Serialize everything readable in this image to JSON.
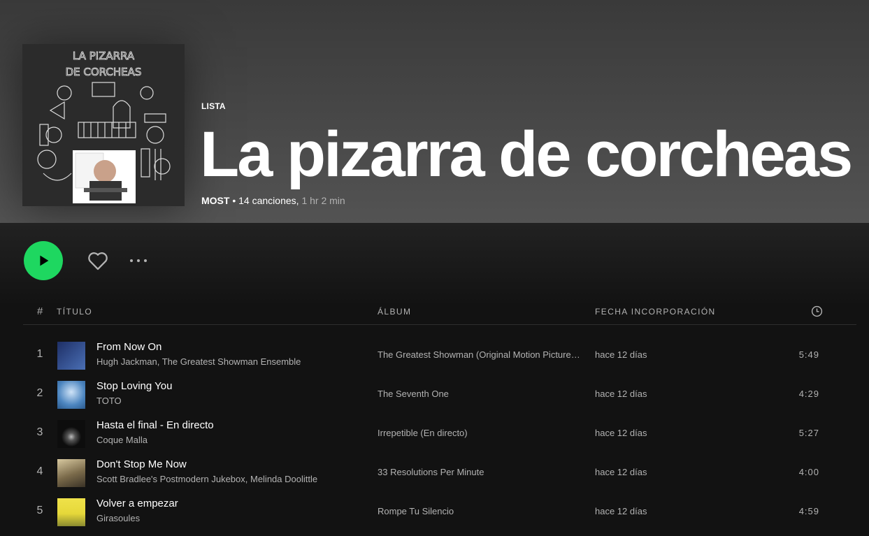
{
  "playlist": {
    "kind": "LISTA",
    "title": "La pizarra de corcheas",
    "owner": "MOST",
    "separator": " • ",
    "songs": "14 canciones,",
    "duration": "1 hr 2 min",
    "cover_text": "LA PIZARRA DE CORCHEAS"
  },
  "actions": {
    "play_icon": "play-icon",
    "like_icon": "heart-icon",
    "more_icon": "more-icon"
  },
  "table": {
    "headers": {
      "num": "#",
      "title": "TÍTULO",
      "album": "ÁLBUM",
      "date": "FECHA INCORPORACIÓN",
      "time_icon": "clock-icon"
    },
    "rows": [
      {
        "num": "1",
        "title": "From Now On",
        "artist": "Hugh Jackman, The Greatest Showman Ensemble",
        "album": "The Greatest Showman (Original Motion Picture Soundtrack)",
        "date": "hace 12 días",
        "time": "5:49",
        "thumb_color": "#2a3f7a"
      },
      {
        "num": "2",
        "title": "Stop Loving You",
        "artist": "TOTO",
        "album": "The Seventh One",
        "date": "hace 12 días",
        "time": "4:29",
        "thumb_color": "#4d86c0"
      },
      {
        "num": "3",
        "title": "Hasta el final - En directo",
        "artist": "Coque Malla",
        "album": "Irrepetible (En directo)",
        "date": "hace 12 días",
        "time": "5:27",
        "thumb_color": "#1a1a1a"
      },
      {
        "num": "4",
        "title": "Don't Stop Me Now",
        "artist": "Scott Bradlee's Postmodern Jukebox, Melinda Doolittle",
        "album": "33 Resolutions Per Minute",
        "date": "hace 12 días",
        "time": "4:00",
        "thumb_color": "#8a7a5a"
      },
      {
        "num": "5",
        "title": "Volver a empezar",
        "artist": "Girasoules",
        "album": "Rompe Tu Silencio",
        "date": "hace 12 días",
        "time": "4:59",
        "thumb_color": "#e6d83a"
      }
    ]
  },
  "colors": {
    "accent": "#1ed760",
    "background": "#121212",
    "header": "#535353"
  }
}
